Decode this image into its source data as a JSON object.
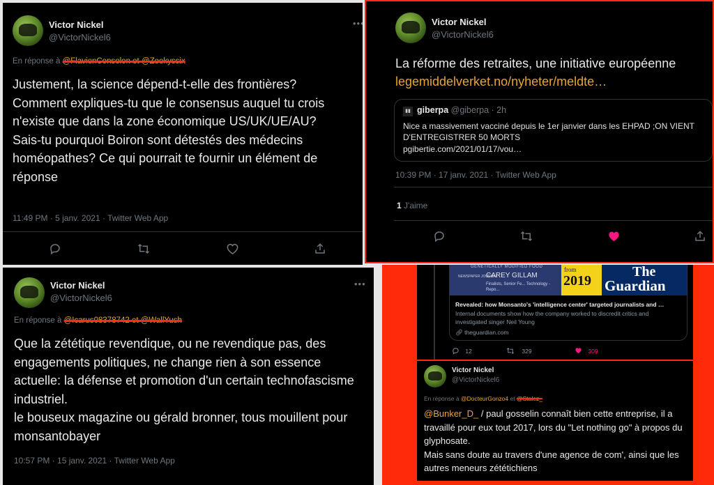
{
  "colors": {
    "accent": "#e8a530",
    "like": "#f91880",
    "highlight_border": "#ff2a1a",
    "red_bg": "#ff2a0a"
  },
  "tweet1": {
    "name": "Victor Nickel",
    "handle": "@VictorNickel6",
    "reply_prefix": "En réponse à",
    "reply_mentions": "@FlavienConsolen et @Zoekyssix",
    "text": "Justement, la science dépend-t-elle des frontières?\nComment expliques-tu que le consensus auquel tu crois n'existe que dans la zone économique US/UK/UE/AU?\nSais-tu pourquoi Boiron sont détestés des médecins homéopathes? Ce qui pourrait te fournir un élément de réponse",
    "meta": "11:49 PM · 5 janv. 2021 · Twitter Web App"
  },
  "tweet2": {
    "name": "Victor Nickel",
    "handle": "@VictorNickel6",
    "text": "La réforme des retraites, une initiative européenne",
    "link": "legemiddelverket.no/nyheter/meldte…",
    "quote": {
      "name": "giberpa",
      "handle": "@giberpa",
      "time": "· 2h",
      "text": "Nice a massivement vacciné depuis le 1er janvier  dans les EHPAD ;ON VIENT D'ENTREGISTRER  50 MORTS",
      "link": "pgibertie.com/2021/01/17/vou…"
    },
    "meta": "10:39 PM · 17 janv. 2021 · Twitter Web App",
    "likes_count": "1",
    "likes_label": "J'aime"
  },
  "tweet3": {
    "name": "Victor Nickel",
    "handle": "@VictorNickel6",
    "reply_prefix": "En réponse à",
    "reply_mentions": "@Icarus08378742 et @WallYush",
    "text": "Que la zététique revendique, ou ne revendique pas, des engagements politiques, ne change rien à son essence actuelle: la défense et promotion d'un certain technofascisme industriel.\nle bouseux magazine ou gérald bronner, tous mouillent pour monsantobayer",
    "meta": "10:57 PM · 15 janv. 2021 · Twitter Web App"
  },
  "tweet4": {
    "card": {
      "image_top": "GENETICALLY MODIFIED FOOD",
      "image_journal": "NEWSPAPER JOURNAL",
      "image_person": "CAREY GILLAM",
      "image_person_sub": "Finalists, Senior Fe... Technology - Repo...",
      "from_label": "from",
      "year": "2019",
      "brand_the": "The",
      "brand_guardian": "Guardian",
      "title": "Revealed: how Monsanto's 'intelligence center' targeted journalists and …",
      "description": "Internal documents show how the company worked to discredit critics and investigated singer Neil Young",
      "domain": "theguardian.com"
    },
    "replies": "12",
    "retweets": "329",
    "likes": "309"
  },
  "tweet5": {
    "name": "Victor Nickel",
    "handle": "@VictorNickel6",
    "reply_prefix": "En réponse à",
    "reply_mention1": "@DocteurGonzo4",
    "reply_and": "et",
    "reply_mention2": "@Stalez_",
    "mention": "@Bunker_D_",
    "text": " / paul gosselin connaît bien cette entreprise, il a travaillé pour eux tout 2017, lors du \"Let nothing go\" à propos du glyphosate.\nMais sans doute au travers d'une agence de com', ainsi que les autres meneurs zététichiens"
  }
}
